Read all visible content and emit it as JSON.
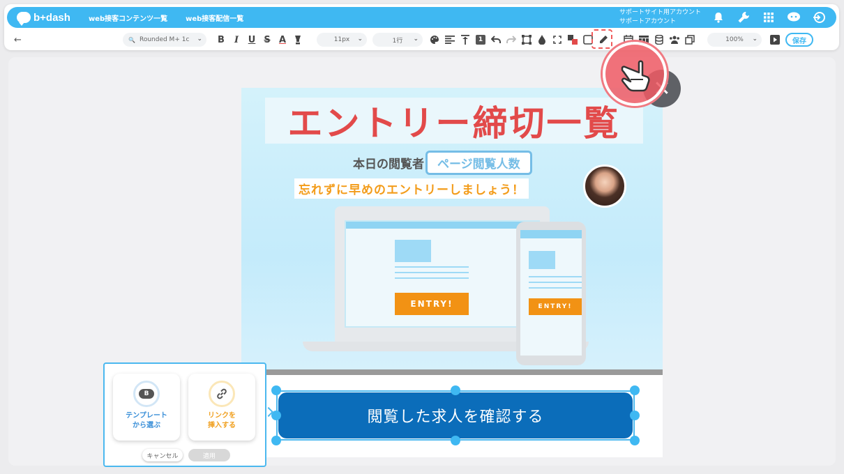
{
  "app": {
    "logo_text": "b+dash",
    "nav_links": [
      "web接客コンテンツ一覧",
      "web接客配信一覧"
    ],
    "account_lines": [
      "サポートサイト用アカウント",
      "サポートアカウント"
    ],
    "nav_icons": [
      "bell-icon",
      "wrench-icon",
      "grid-icon",
      "chat-icon",
      "logout-icon"
    ]
  },
  "toolbar": {
    "back_label": "←",
    "font_value": "Rounded M+ 1c",
    "size_value": "11px",
    "line_value": "1行",
    "zoom_value": "100%",
    "save_label": "保存",
    "text_buttons": [
      "B",
      "I",
      "U",
      "S",
      "A"
    ],
    "one_label": "1"
  },
  "content": {
    "title": "エントリー締切一覧",
    "viewer_prefix": "本日の閲覧者",
    "viewer_tag": "ページ閲覧人数",
    "reminder": "忘れずに早めのエントリーしましょう！",
    "entry_label": "ENTRY!",
    "cta_label": "閲覧した求人を確認する"
  },
  "popup": {
    "template_badge": "B",
    "template_label": "テンプレート\nから選ぶ",
    "link_label": "リンクを\n挿入する",
    "cancel_label": "キャンセル",
    "apply_label": "適用"
  },
  "colors": {
    "brand": "#3fb8f2",
    "title_red": "#e24a4a",
    "cta_blue": "#0b6dba",
    "entry_orange": "#f29214",
    "template_blue": "#3a8fd8",
    "link_orange": "#f0a020"
  }
}
